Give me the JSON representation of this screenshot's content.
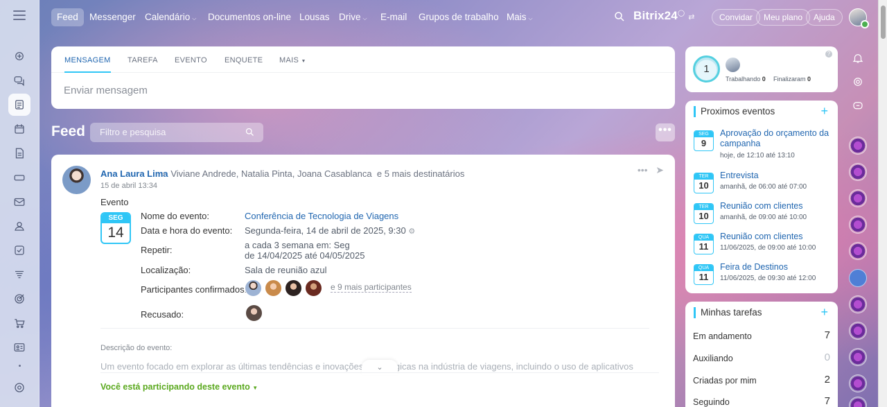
{
  "top_nav": {
    "items": [
      {
        "label": "Feed",
        "active": true,
        "caret": false
      },
      {
        "label": "Messenger",
        "active": false,
        "caret": false
      },
      {
        "label": "Calendário",
        "active": false,
        "caret": true
      },
      {
        "label": "Documentos on-line",
        "active": false,
        "caret": false
      },
      {
        "label": "Lousas",
        "active": false,
        "caret": false
      },
      {
        "label": "Drive",
        "active": false,
        "caret": true
      },
      {
        "label": "E-mail",
        "active": false,
        "caret": false
      },
      {
        "label": "Grupos de trabalho",
        "active": false,
        "caret": false
      },
      {
        "label": "Mais",
        "active": false,
        "caret": true
      }
    ],
    "brand": "Bitrix24",
    "brand_suffix": "24",
    "invite_label": "Convidar",
    "plan_label": "Meu plano",
    "help_label": "Ajuda"
  },
  "composer": {
    "tabs": [
      "MENSAGEM",
      "TAREFA",
      "EVENTO",
      "ENQUETE",
      "MAIS"
    ],
    "placeholder": "Enviar mensagem"
  },
  "feed": {
    "title": "Feed",
    "search_placeholder": "Filtro e pesquisa",
    "more_label": "•••"
  },
  "post": {
    "author": "Ana Laura Lima",
    "recipients": "Viviane Andrede, Natalia Pinta, Joana Casablanca",
    "recipients_more": "e 5 mais destinatários",
    "date": "15 de abril 13:34",
    "type_label": "Evento",
    "calendar": {
      "dow": "SEG",
      "day": "14"
    },
    "fields": {
      "name_label": "Nome do evento:",
      "name_value": "Conferência de Tecnologia de Viagens",
      "datetime_label": "Data e hora do evento:",
      "datetime_value": "Segunda-feira, 14 de abril de 2025, 9:30",
      "repeat_label": "Repetir:",
      "repeat_line1": "a cada 3 semana em: Seg",
      "repeat_line2": "de 14/04/2025 até 04/05/2025",
      "location_label": "Localização:",
      "location_value": "Sala de reunião azul",
      "confirmed_label": "Participantes confirmados:",
      "confirmed_more": "e 9 mais participantes",
      "declined_label": "Recusado:"
    },
    "description_label": "Descrição do evento:",
    "description_text": "Um evento focado em explorar as últimas tendências e inovações tecnológicas na indústria de viagens, incluindo o uso de aplicativos",
    "participating_label": "Você está participando deste evento"
  },
  "stats": {
    "count": "1",
    "working_label": "Trabalhando",
    "working_value": "0",
    "finished_label": "Finalizaram",
    "finished_value": "0"
  },
  "upcoming_events": {
    "title": "Proximos eventos",
    "items": [
      {
        "dow": "SEG",
        "day": "9",
        "title": "Aprovação do orçamento da campanha",
        "time": "hoje, de 12:10 até 13:10"
      },
      {
        "dow": "TER",
        "day": "10",
        "title": "Entrevista",
        "time": "amanhã, de 06:00 até 07:00"
      },
      {
        "dow": "TER",
        "day": "10",
        "title": "Reunião com clientes",
        "time": "amanhã, de 09:00 até 10:00"
      },
      {
        "dow": "QUA",
        "day": "11",
        "title": "Reunião com clientes",
        "time": "11/06/2025, de 09:00 até 10:00"
      },
      {
        "dow": "QUA",
        "day": "11",
        "title": "Feira de Destinos",
        "time": "11/06/2025, de 09:30 até 12:00"
      }
    ]
  },
  "tasks": {
    "title": "Minhas tarefas",
    "rows": [
      {
        "label": "Em andamento",
        "count": "7"
      },
      {
        "label": "Auxiliando",
        "count": "0"
      },
      {
        "label": "Criadas por mim",
        "count": "2"
      },
      {
        "label": "Seguindo",
        "count": "7"
      }
    ]
  },
  "colors": {
    "accent": "#2fc6f6",
    "link": "#2066b0",
    "success": "#5ba91f"
  }
}
